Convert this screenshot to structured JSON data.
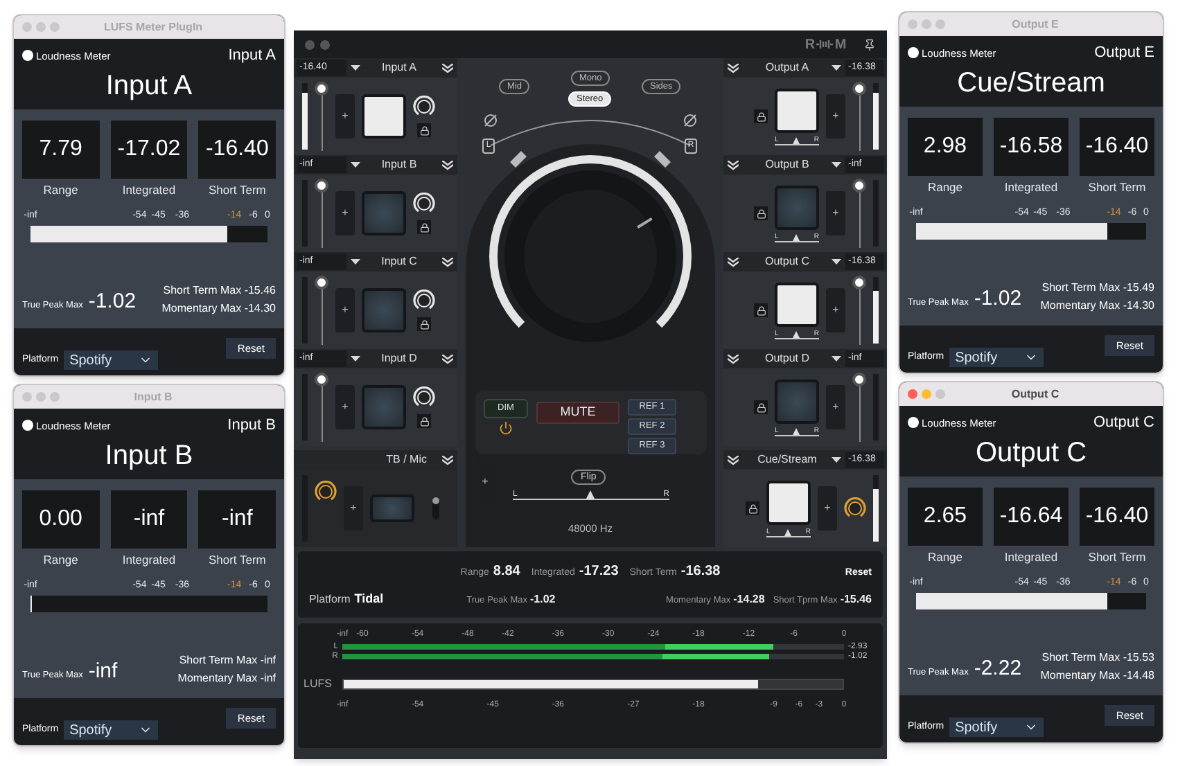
{
  "left_windows": [
    {
      "title": "LUFS Meter PlugIn",
      "focused": false,
      "meter_label": "Loudness Meter",
      "channel": "Input A",
      "name": "Input A",
      "stats": [
        {
          "value": "7.79",
          "label": "Range"
        },
        {
          "value": "-17.02",
          "label": "Integrated"
        },
        {
          "value": "-16.40",
          "label": "Short Term"
        }
      ],
      "scale": [
        {
          "label": "-inf",
          "highlight": false
        },
        {
          "label": "-54",
          "highlight": false
        },
        {
          "label": "-45",
          "highlight": false
        },
        {
          "label": "-36",
          "highlight": false
        },
        {
          "label": "-14",
          "highlight": true
        },
        {
          "label": "-6",
          "highlight": false
        },
        {
          "label": "0",
          "highlight": false
        }
      ],
      "level": 0.83,
      "true_peak": {
        "label": "True Peak Max",
        "value": "-1.02"
      },
      "maxes": [
        {
          "label": "Short Term Max",
          "value": "-15.46"
        },
        {
          "label": "Momentary Max",
          "value": "-14.30"
        }
      ],
      "platform": {
        "label": "Platform",
        "value": "Spotify"
      },
      "reset": "Reset"
    },
    {
      "title": "Input B",
      "focused": false,
      "meter_label": "Loudness Meter",
      "channel": "Input B",
      "name": "Input B",
      "stats": [
        {
          "value": "0.00",
          "label": "Range"
        },
        {
          "value": "-inf",
          "label": "Integrated"
        },
        {
          "value": "-inf",
          "label": "Short Term"
        }
      ],
      "scale": [
        {
          "label": "-inf",
          "highlight": false
        },
        {
          "label": "-54",
          "highlight": false
        },
        {
          "label": "-45",
          "highlight": false
        },
        {
          "label": "-36",
          "highlight": false
        },
        {
          "label": "-14",
          "highlight": true
        },
        {
          "label": "-6",
          "highlight": false
        },
        {
          "label": "0",
          "highlight": false
        }
      ],
      "level": 0,
      "true_peak": {
        "label": "True Peak Max",
        "value": "-inf"
      },
      "maxes": [
        {
          "label": "Short Term Max",
          "value": "-inf"
        },
        {
          "label": "Momentary Max",
          "value": "-inf"
        }
      ],
      "platform": {
        "label": "Platform",
        "value": "Spotify"
      },
      "reset": "Reset"
    }
  ],
  "mixer": {
    "logo": {
      "left": "R",
      "right": "M"
    },
    "inputs": [
      {
        "reading": "-16.40",
        "name": "Input A",
        "level": 0.85,
        "fader": {
          "level": 1
        },
        "lit": true,
        "plus": "+"
      },
      {
        "reading": "-inf",
        "name": "Input B",
        "level": 0,
        "fader": {
          "level": 1
        },
        "lit": false,
        "plus": "+"
      },
      {
        "reading": "-inf",
        "name": "Input C",
        "level": 0,
        "fader": {
          "level": 1
        },
        "lit": false,
        "plus": "+"
      },
      {
        "reading": "-inf",
        "name": "Input D",
        "level": 0,
        "fader": {
          "level": 1
        },
        "lit": false,
        "plus": "+"
      }
    ],
    "talkback": {
      "name": "TB / Mic",
      "level": 0,
      "lit": false,
      "plus": "+",
      "switch": {
        "on": true
      }
    },
    "monitor_modes": [
      {
        "label": "Mid",
        "selected": false
      },
      {
        "label": "Mono",
        "selected": false
      },
      {
        "label": "Stereo",
        "selected": true
      },
      {
        "label": "Sides",
        "selected": false
      }
    ],
    "speakers": {
      "left": "L",
      "right": "R"
    },
    "volume": {
      "level": 0.95
    },
    "dim": "DIM",
    "mute": "MUTE",
    "refs": [
      "REF 1",
      "REF 2",
      "REF 3"
    ],
    "plus": "+",
    "flip": "Flip",
    "pan": {
      "left": "L",
      "right": "R"
    },
    "sample_rate": "48000 Hz",
    "outputs": [
      {
        "name": "Output A",
        "reading": "-16.38",
        "level": 0.85,
        "fader": {
          "level": 1
        },
        "lit": true,
        "plus": "+",
        "pan": {
          "left": "L",
          "right": "R"
        }
      },
      {
        "name": "Output B",
        "reading": "-inf",
        "level": 0,
        "fader": {
          "level": 1
        },
        "lit": false,
        "plus": "+",
        "pan": {
          "left": "L",
          "right": "R"
        }
      },
      {
        "name": "Output C",
        "reading": "-16.38",
        "level": 0.8,
        "fader": {
          "level": 1
        },
        "lit": true,
        "plus": "+",
        "pan": {
          "left": "L",
          "right": "R"
        }
      },
      {
        "name": "Output D",
        "reading": "-inf",
        "level": 0,
        "fader": {
          "level": 1
        },
        "lit": false,
        "plus": "+",
        "pan": {
          "left": "L",
          "right": "R"
        }
      }
    ],
    "cue": {
      "name": "Cue/Stream",
      "reading": "-16.38",
      "level": 0.8,
      "lit": true,
      "plus": "+",
      "pan": {
        "left": "L",
        "right": "R"
      }
    },
    "summary": {
      "stats": [
        {
          "label": "Range",
          "value": "8.84"
        },
        {
          "label": "Integrated",
          "value": "-17.23"
        },
        {
          "label": "Short Term",
          "value": "-16.38"
        }
      ],
      "reset": "Reset",
      "platform": {
        "label": "Platform",
        "value": "Tidal"
      },
      "maxes": [
        {
          "label": "True Peak Max",
          "value": "-1.02"
        },
        {
          "label": "Momentary Max",
          "value": "-14.28"
        },
        {
          "label": "Short Tprm Max",
          "value": "-15.46"
        }
      ]
    },
    "meter": {
      "scale": [
        "-inf",
        "-60",
        "-54",
        "-48",
        "-42",
        "-36",
        "-30",
        "-24",
        "-18",
        "-12",
        "-6",
        "0"
      ],
      "channels": [
        {
          "name": "L",
          "level": 0.86,
          "reading": "-2.93"
        },
        {
          "name": "R",
          "level": 0.85,
          "reading": "-1.02"
        }
      ],
      "lufs": {
        "label": "LUFS",
        "level": 0.83
      },
      "lufs_scale": [
        "-inf",
        "-54",
        "-45",
        "-36",
        "-27",
        "-18",
        "-9",
        "-6",
        "-3",
        "0"
      ]
    }
  },
  "right_windows": [
    {
      "title": "Output E",
      "focused": false,
      "meter_label": "Loudness Meter",
      "channel": "Output E",
      "name": "Cue/Stream",
      "stats": [
        {
          "value": "2.98",
          "label": "Range"
        },
        {
          "value": "-16.58",
          "label": "Integrated"
        },
        {
          "value": "-16.40",
          "label": "Short Term"
        }
      ],
      "scale": [
        {
          "label": "-inf",
          "highlight": false
        },
        {
          "label": "-54",
          "highlight": false
        },
        {
          "label": "-45",
          "highlight": false
        },
        {
          "label": "-36",
          "highlight": false
        },
        {
          "label": "-14",
          "highlight": true
        },
        {
          "label": "-6",
          "highlight": false
        },
        {
          "label": "0",
          "highlight": false
        }
      ],
      "level": 0.83,
      "true_peak": {
        "label": "True Peak Max",
        "value": "-1.02"
      },
      "maxes": [
        {
          "label": "Short Term Max",
          "value": "-15.49"
        },
        {
          "label": "Momentary Max",
          "value": "-14.30"
        }
      ],
      "platform": {
        "label": "Platform",
        "value": "Spotify"
      },
      "reset": "Reset"
    },
    {
      "title": "Output C",
      "focused": true,
      "meter_label": "Loudness Meter",
      "channel": "Output C",
      "name": "Output C",
      "stats": [
        {
          "value": "2.65",
          "label": "Range"
        },
        {
          "value": "-16.64",
          "label": "Integrated"
        },
        {
          "value": "-16.40",
          "label": "Short Term"
        }
      ],
      "scale": [
        {
          "label": "-inf",
          "highlight": false
        },
        {
          "label": "-54",
          "highlight": false
        },
        {
          "label": "-45",
          "highlight": false
        },
        {
          "label": "-36",
          "highlight": false
        },
        {
          "label": "-14",
          "highlight": true
        },
        {
          "label": "-6",
          "highlight": false
        },
        {
          "label": "0",
          "highlight": false
        }
      ],
      "level": 0.83,
      "true_peak": {
        "label": "True Peak Max",
        "value": "-2.22"
      },
      "maxes": [
        {
          "label": "Short Term Max",
          "value": "-15.53"
        },
        {
          "label": "Momentary Max",
          "value": "-14.48"
        }
      ],
      "platform": {
        "label": "Platform",
        "value": "Spotify"
      },
      "reset": "Reset"
    }
  ]
}
